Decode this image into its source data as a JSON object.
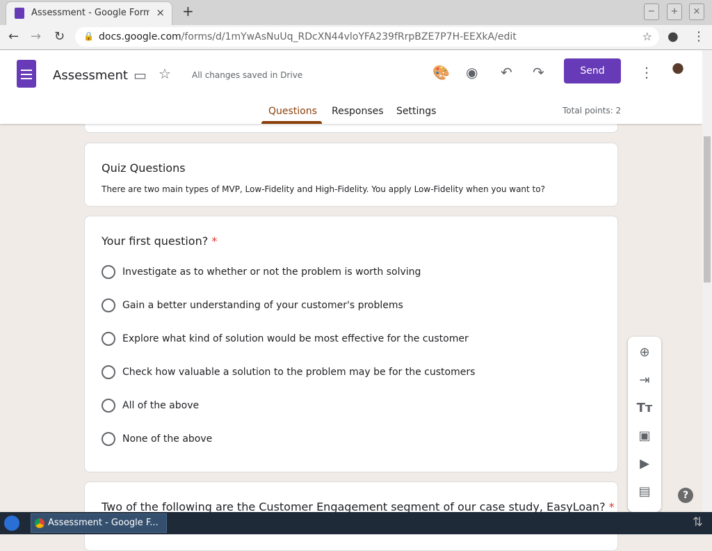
{
  "browser": {
    "tab_title": "Assessment - Google Forms",
    "taskbar_title": "Assessment - Google F...",
    "url_domain": "docs.google.com",
    "url_path": "/forms/d/1mYwAsNuUq_RDcXN44vloYFA239fRrpBZE7P7H-EEXkA/edit"
  },
  "header": {
    "title": "Assessment",
    "saved": "All changes saved in Drive",
    "send": "Send",
    "tabs": [
      "Questions",
      "Responses",
      "Settings"
    ],
    "total_points": "Total points: 2"
  },
  "section": {
    "title": "Quiz Questions",
    "description": "There are two main types of MVP, Low-Fidelity and High-Fidelity. You apply Low-Fidelity when you want to?"
  },
  "q1": {
    "title": "Your first question?",
    "required": "*",
    "options": [
      "Investigate as to whether or not the problem is worth solving",
      "Gain a better understanding of your customer's problems",
      "Explore what kind of solution would be most effective for the customer",
      "Check how valuable a solution to the problem may be for the customers",
      "All of the above",
      "None of the above"
    ]
  },
  "q2": {
    "title": "Two of the following are the Customer Engagement segment of our case study, EasyLoan?",
    "required": "*"
  },
  "help": "?"
}
